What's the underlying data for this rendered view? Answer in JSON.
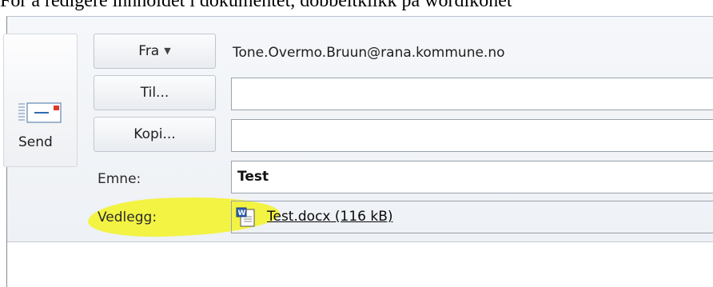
{
  "caption": "For å redigere innholdet i dokumentet, dobbeltklikk på wordikonet",
  "send": {
    "label": "Send",
    "icon": "send-envelope-icon"
  },
  "header": {
    "from": {
      "button_label": "Fra",
      "address": "Tone.Overmo.Bruun@rana.kommune.no"
    },
    "to": {
      "button_label": "Til...",
      "value": ""
    },
    "cc": {
      "button_label": "Kopi...",
      "value": ""
    },
    "subject": {
      "label": "Emne:",
      "value": "Test"
    },
    "attachment": {
      "label": "Vedlegg:",
      "file": "Test.docx (116 kB)",
      "icon": "word-document-icon"
    }
  },
  "colors": {
    "highlight": "#f2f23a",
    "window_border": "#8a8a8a",
    "field_border": "#9aa3ad"
  }
}
